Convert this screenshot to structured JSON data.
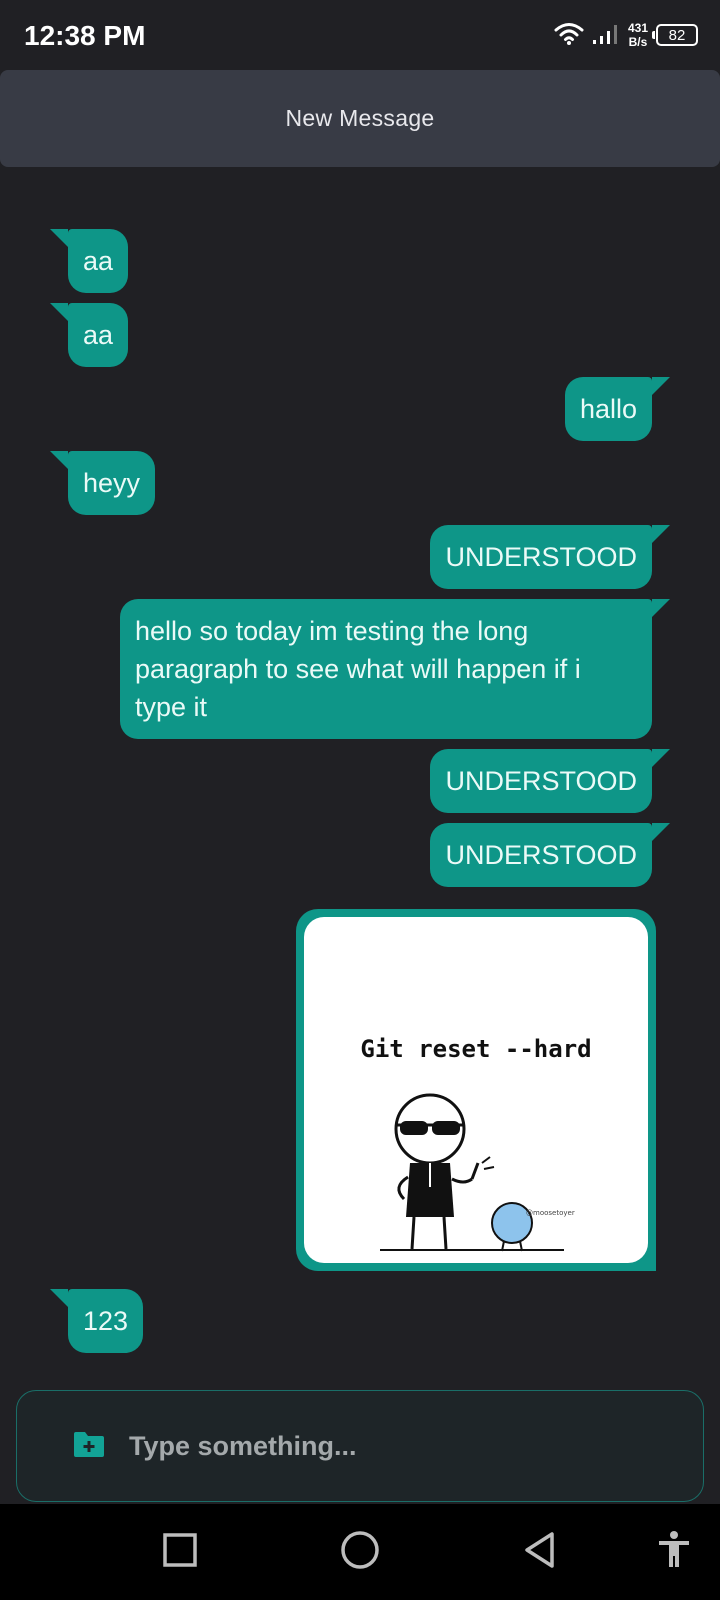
{
  "status_bar": {
    "time": "12:38 PM",
    "net_speed_value": "431",
    "net_speed_unit": "B/s",
    "battery": "82"
  },
  "header": {
    "title": "New Message"
  },
  "messages": [
    {
      "text": "aa",
      "direction": "received"
    },
    {
      "text": "aa",
      "direction": "received"
    },
    {
      "text": "hallo",
      "direction": "sent"
    },
    {
      "text": "heyy",
      "direction": "received"
    },
    {
      "text": "UNDERSTOOD",
      "direction": "sent"
    },
    {
      "text": "hello so today im testing the long paragraph to see what will happen if i type it",
      "direction": "sent"
    },
    {
      "text": "UNDERSTOOD",
      "direction": "sent"
    },
    {
      "text": "UNDERSTOOD",
      "direction": "sent"
    },
    {
      "type": "image",
      "direction": "sent",
      "image_caption": "Git reset --hard",
      "image_signature": "@moosetoyer"
    },
    {
      "text": "123",
      "direction": "received"
    }
  ],
  "composer": {
    "placeholder": "Type something...",
    "attach_icon": "folder-plus-icon"
  },
  "nav_bar": {
    "icons": [
      "recents-square-icon",
      "home-circle-icon",
      "back-triangle-icon",
      "accessibility-icon"
    ]
  },
  "colors": {
    "background": "#202024",
    "header": "#383b45",
    "bubble": "#0e9688",
    "composer_border": "#1a6e68"
  }
}
